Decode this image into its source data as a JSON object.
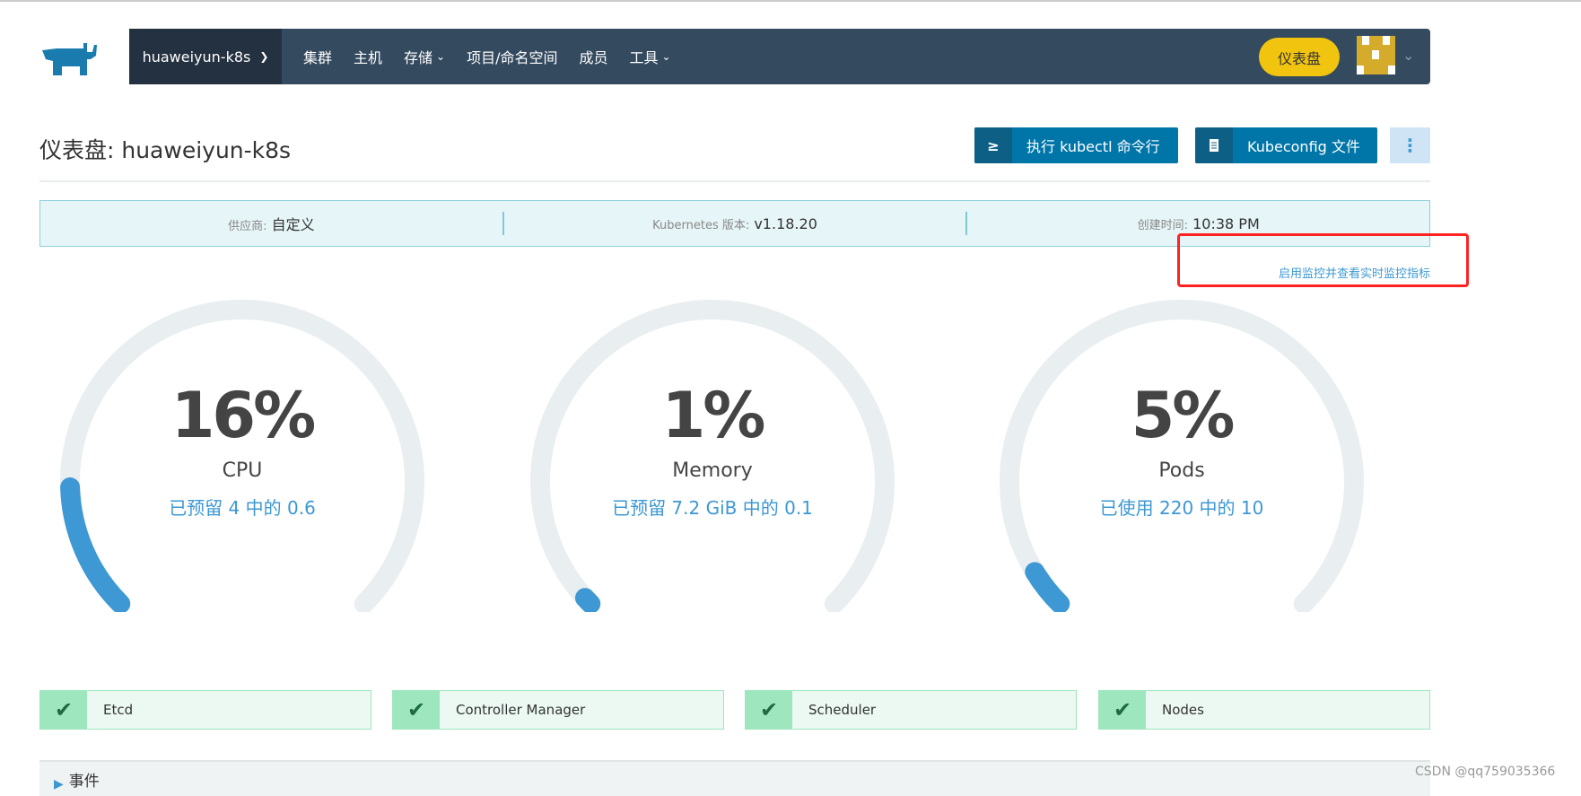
{
  "nav": {
    "cluster": "huaweiyun-k8s",
    "items": [
      {
        "label": "集群",
        "dropdown": false
      },
      {
        "label": "主机",
        "dropdown": false
      },
      {
        "label": "存储",
        "dropdown": true
      },
      {
        "label": "项目/命名空间",
        "dropdown": false
      },
      {
        "label": "成员",
        "dropdown": false
      },
      {
        "label": "工具",
        "dropdown": true
      }
    ],
    "dashboard": "仪表盘"
  },
  "header": {
    "title": "仪表盘: huaweiyun-k8s",
    "kubectl_icon": "≥",
    "kubectl": "执行 kubectl 命令行",
    "kubeconfig_icon": "file-icon",
    "kubeconfig": "Kubeconfig 文件",
    "more": "⋮"
  },
  "info": {
    "provider_label": "供应商:",
    "provider": "自定义",
    "version_label": "Kubernetes 版本:",
    "version": "v1.18.20",
    "created_label": "创建时间:",
    "created": "10:38 PM"
  },
  "monitor_link": "启用监控并查看实时监控指标",
  "gauges": [
    {
      "value": "16%",
      "fraction": 0.16,
      "label": "CPU",
      "sub": "已预留 4 中的 0.6"
    },
    {
      "value": "1%",
      "fraction": 0.01,
      "label": "Memory",
      "sub": "已预留 7.2 GiB 中的 0.1"
    },
    {
      "value": "5%",
      "fraction": 0.05,
      "label": "Pods",
      "sub": "已使用 220 中的 10"
    }
  ],
  "colors": {
    "accent": "#3d98d3",
    "track": "#e9eef0",
    "nav": "#344a5f",
    "ok": "#9ee6bd"
  },
  "components": [
    {
      "name": "Etcd",
      "status": "ok"
    },
    {
      "name": "Controller Manager",
      "status": "ok"
    },
    {
      "name": "Scheduler",
      "status": "ok"
    },
    {
      "name": "Nodes",
      "status": "ok"
    }
  ],
  "events": {
    "label": "事件"
  },
  "watermark": "CSDN @qq759035366"
}
